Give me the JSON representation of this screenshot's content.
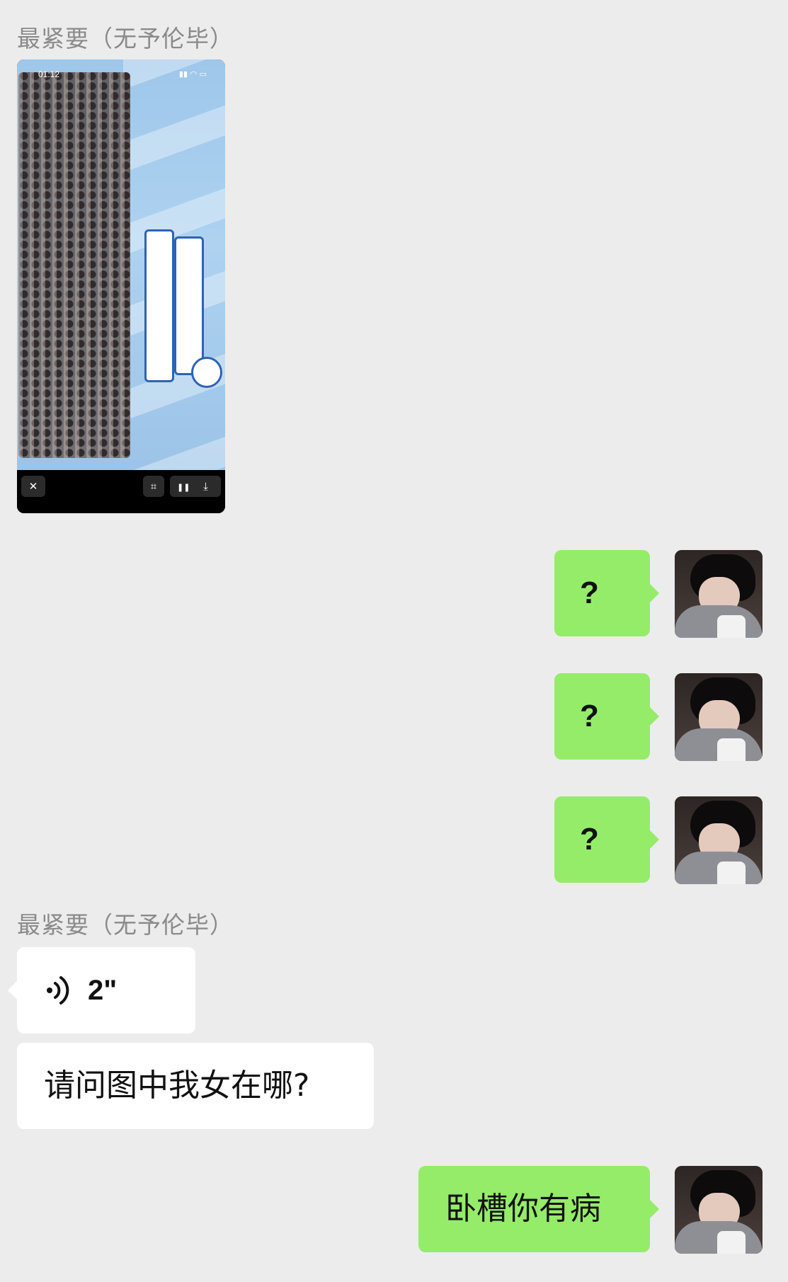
{
  "chat": {
    "contact_name": "最紧要（无予伦毕）",
    "messages": [
      {
        "from": "contact",
        "kind": "image",
        "image_desc_icon": "screenshot-image",
        "image": {
          "status_time": "01:12",
          "close_label": "✕",
          "pause_label": "❚❚",
          "download_label": "⤓",
          "scan_label": "⌗"
        }
      },
      {
        "from": "me",
        "kind": "text",
        "text": "?"
      },
      {
        "from": "me",
        "kind": "text",
        "text": "?"
      },
      {
        "from": "me",
        "kind": "text",
        "text": "?"
      },
      {
        "from": "contact",
        "kind": "voice",
        "duration": "2\""
      },
      {
        "from": "contact",
        "kind": "text",
        "text": "请问图中我女在哪?"
      },
      {
        "from": "me",
        "kind": "text",
        "text": "卧槽你有病"
      }
    ]
  },
  "colors": {
    "background": "#ececec",
    "my_bubble": "#95ec69",
    "their_bubble": "#ffffff",
    "sender_name": "#8a8a8a"
  },
  "icons": {
    "voice": "voice-wave-icon",
    "avatar": "user-avatar"
  }
}
